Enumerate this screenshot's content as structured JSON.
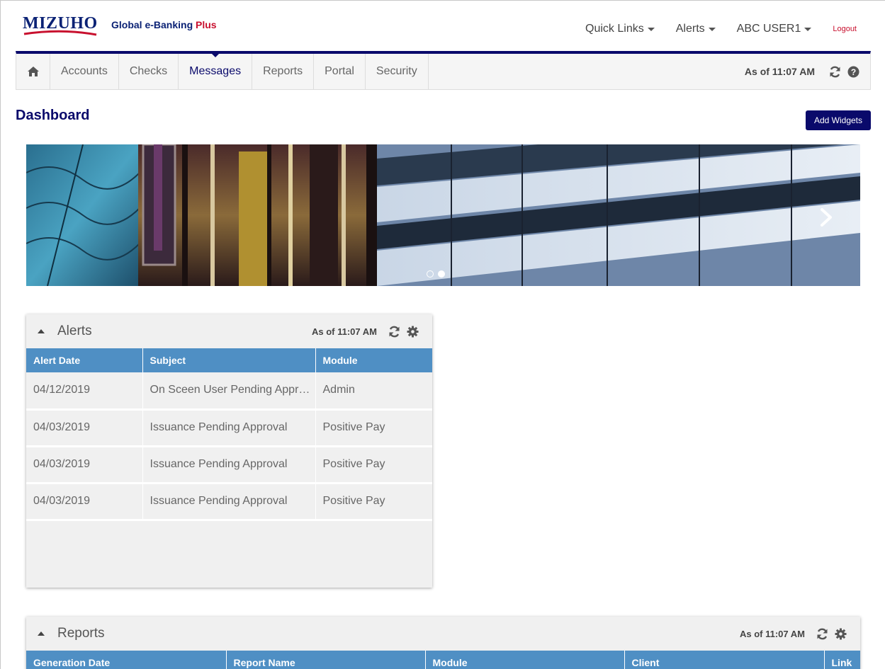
{
  "brand": {
    "logo_text": "MIZUHO",
    "product_name": "Global e-Banking",
    "product_suffix": "Plus",
    "logo_color": "#0b2275",
    "accent_color": "#c8102e"
  },
  "topnav": {
    "quick_links": "Quick Links",
    "alerts": "Alerts",
    "user": "ABC USER1",
    "logout": "Logout"
  },
  "mainnav": {
    "home_icon": "home-icon",
    "items": [
      {
        "label": "Accounts",
        "active": false
      },
      {
        "label": "Checks",
        "active": false
      },
      {
        "label": "Messages",
        "active": true
      },
      {
        "label": "Reports",
        "active": false
      },
      {
        "label": "Portal",
        "active": false
      },
      {
        "label": "Security",
        "active": false
      }
    ],
    "as_of": "As of 11:07 AM",
    "refresh_icon": "refresh-icon",
    "help_icon": "help-icon",
    "bar_color": "#0a0a6b"
  },
  "page": {
    "title": "Dashboard",
    "add_widgets": "Add Widgets"
  },
  "carousel": {
    "slides": 2,
    "active_slide": 2,
    "next_icon": "chevron-right-icon"
  },
  "alerts_widget": {
    "title": "Alerts",
    "as_of": "As of 11:07 AM",
    "columns": [
      "Alert Date",
      "Subject",
      "Module"
    ],
    "rows": [
      [
        "04/12/2019",
        "On Sceen User Pending Approval",
        "Admin"
      ],
      [
        "04/03/2019",
        "Issuance Pending Approval",
        "Positive Pay"
      ],
      [
        "04/03/2019",
        "Issuance Pending Approval",
        "Positive Pay"
      ],
      [
        "04/03/2019",
        "Issuance Pending Approval",
        "Positive Pay"
      ]
    ],
    "header_color": "#4f8fc4"
  },
  "reports_widget": {
    "title": "Reports",
    "as_of": "As of 11:07 AM",
    "columns": [
      "Generation Date",
      "Report Name",
      "Module",
      "Client",
      "Link"
    ]
  }
}
